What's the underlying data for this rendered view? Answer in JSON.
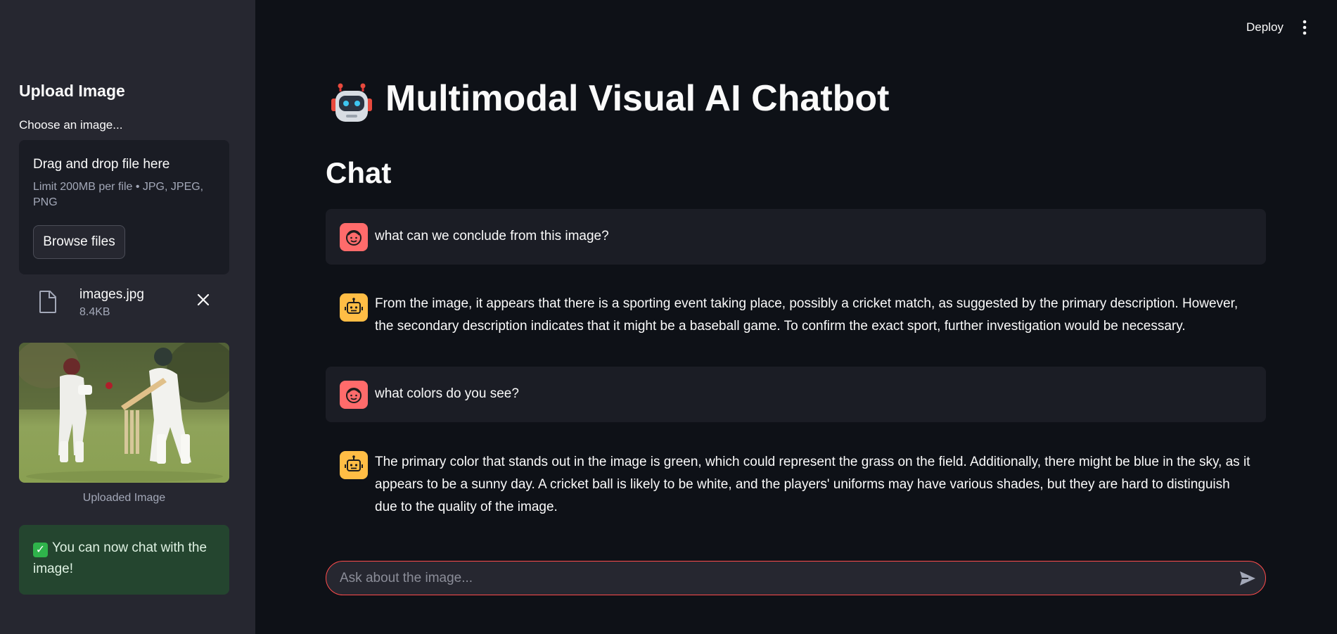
{
  "header": {
    "deploy_label": "Deploy"
  },
  "sidebar": {
    "title": "Upload Image",
    "uploader_label": "Choose an image...",
    "dropzone_title": "Drag and drop file here",
    "dropzone_limit": "Limit 200MB per file • JPG, JPEG, PNG",
    "browse_label": "Browse files",
    "file": {
      "name": "images.jpg",
      "size": "8.4KB"
    },
    "image_caption": "Uploaded Image",
    "success_text": "You can now chat with the image!"
  },
  "main": {
    "title": "Multimodal Visual AI Chatbot",
    "chat_heading": "Chat",
    "messages": [
      {
        "role": "user",
        "text": "what can we conclude from this image?"
      },
      {
        "role": "assistant",
        "text": "From the image, it appears that there is a sporting event taking place, possibly a cricket match, as suggested by the primary description. However, the secondary description indicates that it might be a baseball game. To confirm the exact sport, further investigation would be necessary."
      },
      {
        "role": "user",
        "text": "what colors do you see?"
      },
      {
        "role": "assistant",
        "text": "The primary color that stands out in the image is green, which could represent the grass on the field. Additionally, there might be blue in the sky, as it appears to be a sunny day. A cricket ball is likely to be white, and the players' uniforms may have various shades, but they are hard to distinguish due to the quality of the image."
      }
    ],
    "input_placeholder": "Ask about the image..."
  },
  "colors": {
    "background": "#0e1117",
    "sidebar": "#262730",
    "accent": "#ff4b4b",
    "user_avatar": "#ff6b6b",
    "assistant_avatar": "#ffbd45",
    "success_bg": "#24452f"
  },
  "icons": {
    "title_icon": "robot-icon",
    "user_avatar": "smiley-face-icon",
    "assistant_avatar": "robot-face-icon",
    "file": "file-icon",
    "close": "close-icon",
    "menu": "vertical-dots-icon",
    "send": "send-icon",
    "success": "check-icon"
  }
}
